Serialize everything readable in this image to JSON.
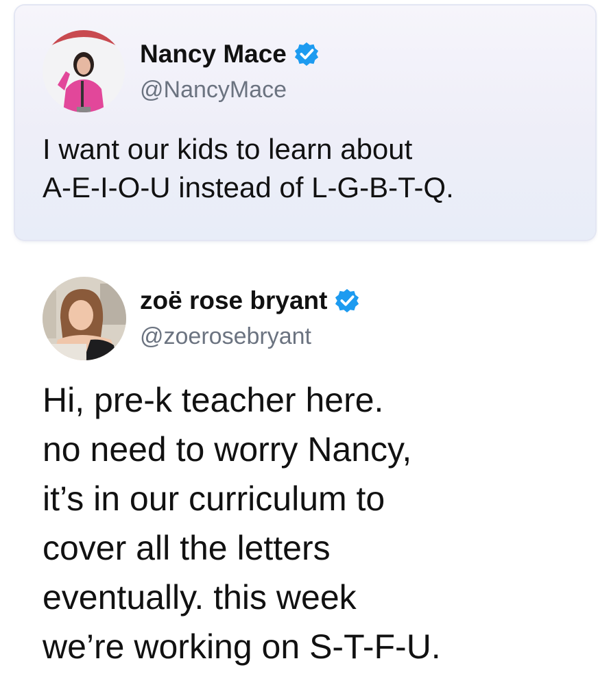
{
  "quoted_tweet": {
    "display_name": "Nancy Mace",
    "handle": "@NancyMace",
    "verified": true,
    "avatar_icon": "user-avatar-photo",
    "text": "I want our kids to learn about\nA-E-I-O-U instead of L-G-B-T-Q."
  },
  "reply_tweet": {
    "display_name": "zoë rose bryant",
    "handle": "@zoerosebryant",
    "verified": true,
    "avatar_icon": "user-avatar-photo",
    "text": "Hi, pre-k teacher here.\nno need to worry Nancy,\nit’s in our curriculum to\ncover all the letters\neventually. this week\nwe’re working on S-T-F-U."
  },
  "colors": {
    "verified_badge": "#1d9bf0",
    "handle_text": "#6b7380",
    "card_background": "#eeeef8"
  }
}
